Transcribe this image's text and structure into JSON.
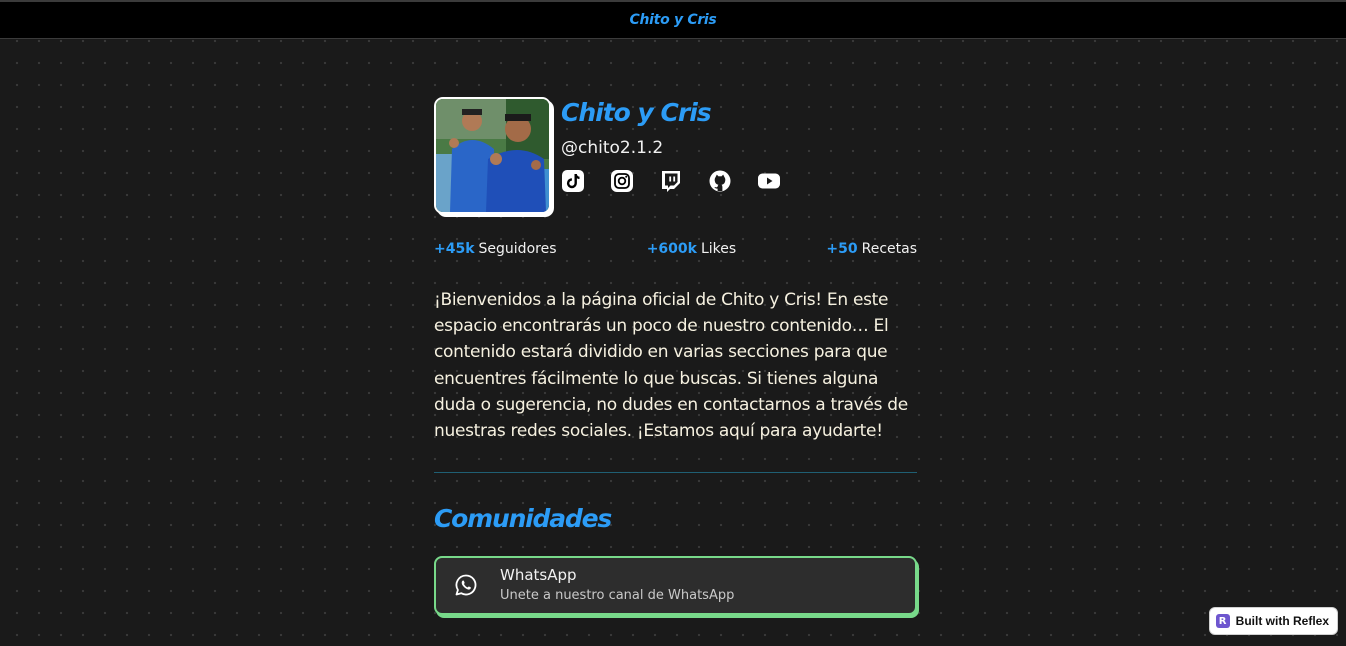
{
  "navbar": {
    "brand": "Chito y Cris"
  },
  "profile": {
    "name": "Chito y Cris",
    "handle": "@chito2.1.2",
    "avatar_icon": "profile-photo",
    "socials": [
      {
        "name": "tiktok",
        "icon": "tiktok-icon"
      },
      {
        "name": "instagram",
        "icon": "instagram-icon"
      },
      {
        "name": "twitch",
        "icon": "twitch-icon"
      },
      {
        "name": "github",
        "icon": "github-icon"
      },
      {
        "name": "youtube",
        "icon": "youtube-icon"
      }
    ]
  },
  "stats": [
    {
      "value": "+45k",
      "label": "Seguidores"
    },
    {
      "value": "+600k",
      "label": "Likes"
    },
    {
      "value": "+50",
      "label": "Recetas"
    }
  ],
  "description": "¡Bienvenidos a la página oficial de Chito y Cris! En este espacio encontrarás un poco de nuestro contenido… El contenido estará dividido en varias secciones para que encuentres fácilmente lo que buscas. Si tienes alguna duda o sugerencia, no dudes en contactarnos a través de nuestras redes sociales. ¡Estamos aquí para ayudarte!",
  "communities": {
    "title": "Comunidades",
    "items": [
      {
        "title": "WhatsApp",
        "subtitle": "Unete a nuestro canal de WhatsApp",
        "icon": "whatsapp-icon"
      }
    ]
  },
  "badge": {
    "logo_letter": "R",
    "label": "Built with Reflex"
  },
  "colors": {
    "accent": "#2c9cf6",
    "background": "#1a1a1a",
    "card_border": "#78d98a"
  }
}
